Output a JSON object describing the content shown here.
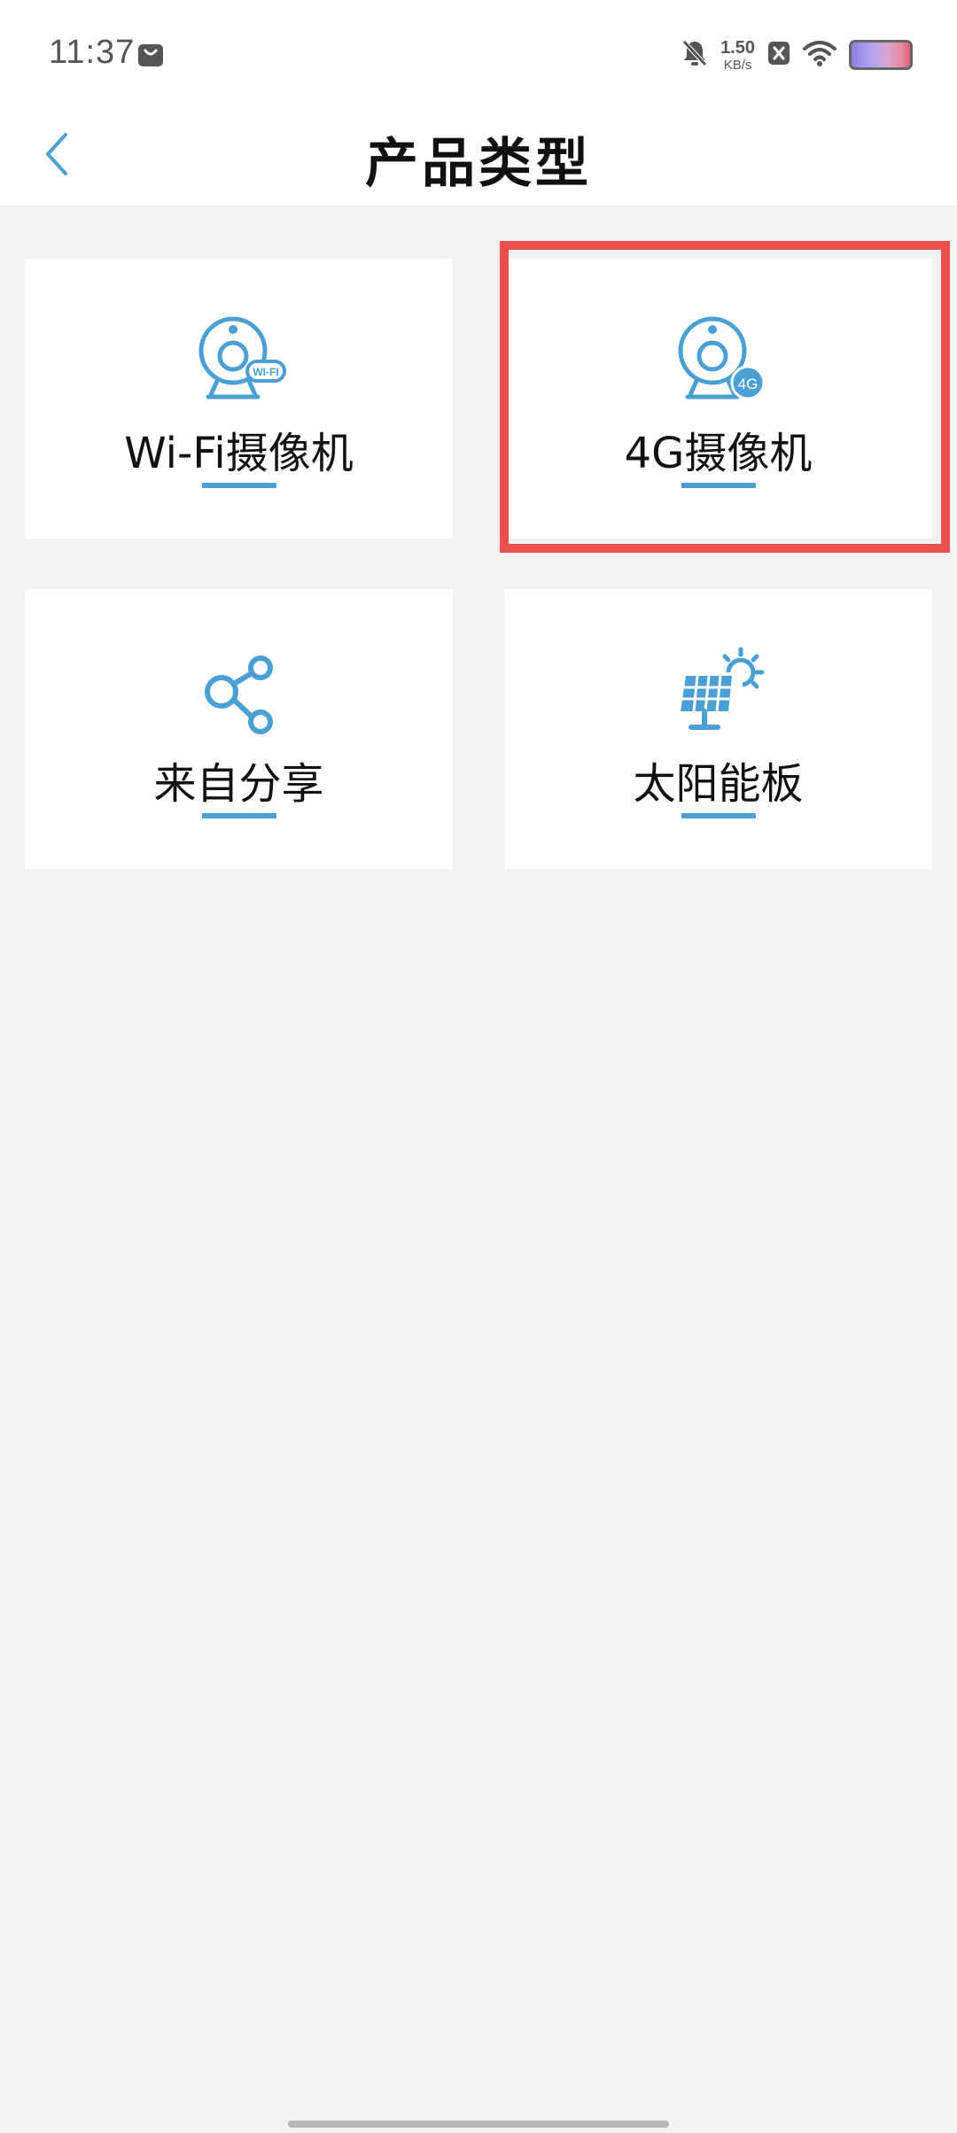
{
  "status_bar": {
    "time": "11:37",
    "net_speed_value": "1.50",
    "net_speed_unit": "KB/s",
    "icons": [
      "shopping-bag-icon",
      "mute-bell-icon",
      "x-box-icon",
      "wifi-icon",
      "battery-icon"
    ]
  },
  "header": {
    "title": "产品类型",
    "back_icon": "chevron-left-icon"
  },
  "cards": [
    {
      "label": "Wi-Fi摄像机",
      "icon": "wifi-camera-icon",
      "icon_badge": "WI-FI"
    },
    {
      "label": "4G摄像机",
      "icon": "4g-camera-icon",
      "icon_badge": "4G"
    },
    {
      "label": "来自分享",
      "icon": "share-icon"
    },
    {
      "label": "太阳能板",
      "icon": "solar-panel-icon"
    }
  ],
  "colors": {
    "accent": "#4a9fd4",
    "highlight": "#e8504a",
    "background": "#f2f2f2"
  }
}
